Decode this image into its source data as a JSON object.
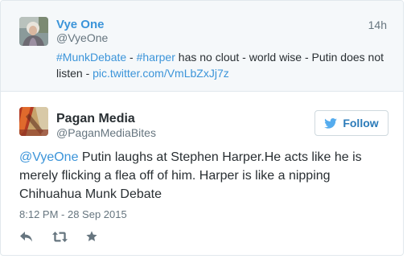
{
  "parent_tweet": {
    "name": "Vye One",
    "handle": "@VyeOne",
    "time": "14h",
    "avatar_icon": "user-avatar-photo",
    "text_parts": {
      "hashtag1": "#MunkDebate",
      "sep1": " - ",
      "hashtag2": "#harper",
      "body": " has no clout - world wise - Putin does not listen - ",
      "link": "pic.twitter.com/VmLbZxJj7z"
    }
  },
  "tweet": {
    "name": "Pagan Media",
    "handle": "@PaganMediaBites",
    "avatar_icon": "pagan-media-avatar",
    "follow_label": "Follow",
    "text_parts": {
      "mention": "@VyeOne",
      "body": " Putin laughs at Stephen Harper.He acts like he is merely flicking a flea off of him. Harper is like a nipping Chihuahua Munk Debate"
    },
    "date": "8:12 PM - 28 Sep 2015",
    "actions": [
      "reply-icon",
      "retweet-icon",
      "favorite-icon"
    ]
  },
  "colors": {
    "link": "#3b94d9",
    "text": "#292f33",
    "muted": "#66757f",
    "parent_bg": "#f5f8fa",
    "border": "#e1e8ed",
    "follow": "#2b7bb9"
  }
}
